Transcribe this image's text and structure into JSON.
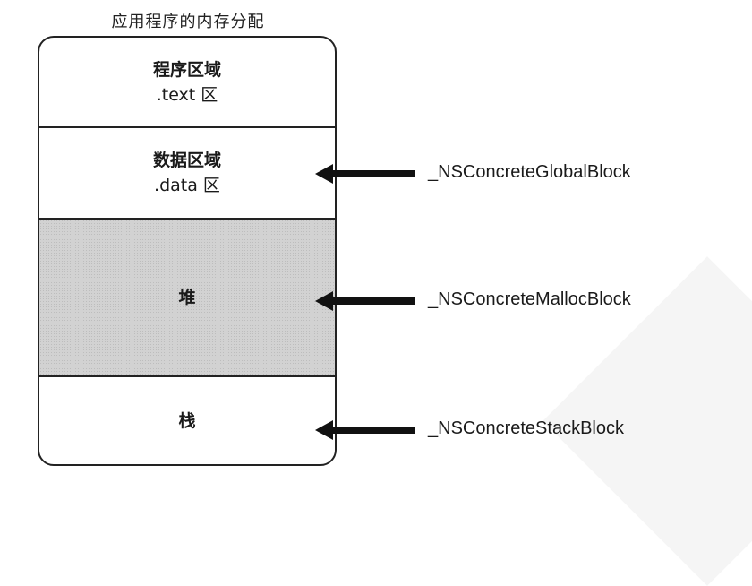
{
  "title": "应用程序的内存分配",
  "segments": {
    "text": {
      "name": "程序区域",
      "sub": ".text 区"
    },
    "data": {
      "name": "数据区域",
      "sub": ".data 区"
    },
    "heap": {
      "name": "堆"
    },
    "stack": {
      "name": "栈"
    }
  },
  "block_types": {
    "global": "_NSConcreteGlobalBlock",
    "malloc": "_NSConcreteMallocBlock",
    "stack": "_NSConcreteStackBlock"
  },
  "colors": {
    "heap_fill": "#d2d2d2",
    "line": "#222222"
  }
}
